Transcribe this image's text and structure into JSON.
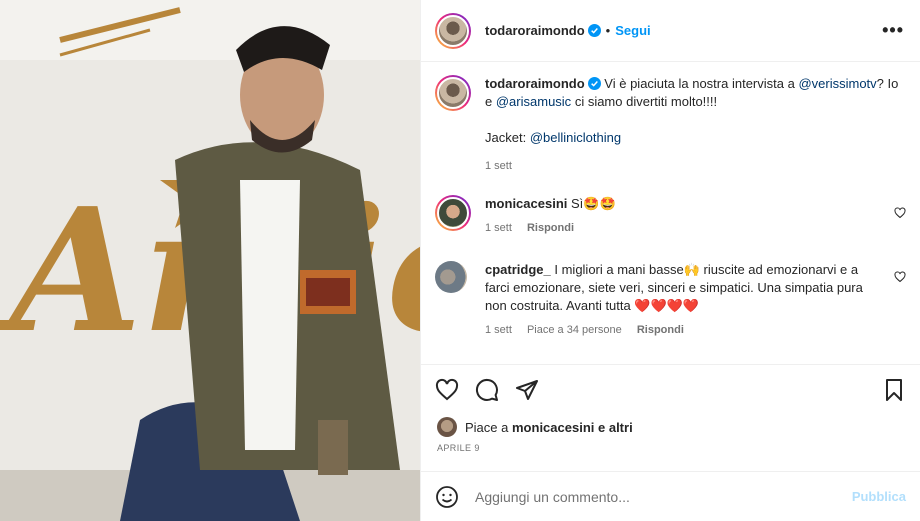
{
  "post": {
    "author": "todaroraimondo",
    "follow_label": "Segui",
    "separator": "•",
    "more_label": "•••",
    "photo_sign_text": "Amici"
  },
  "caption": {
    "author": "todaroraimondo",
    "text_1": "Vi è piaciuta la nostra intervista a",
    "mention_1": "@verissimotv",
    "text_2": "? Io e",
    "mention_2": "@arisamusic",
    "text_3": "ci siamo divertiti molto!!!!",
    "jacket_label": "Jacket:",
    "jacket_mention": "@belliniclothing",
    "time": "1 sett"
  },
  "comments": [
    {
      "author": "monicacesini",
      "text": "Sì🤩🤩",
      "time": "1 sett",
      "reply_label": "Rispondi"
    },
    {
      "author": "cpatridge_",
      "text": "I migliori a mani basse🙌 riuscite ad emozionarvi e a farci emozionare, siete veri, sinceri e simpatici. Una simpatia pura non costruita. Avanti tutta ❤️❤️❤️❤️",
      "time": "1 sett",
      "likes_label": "Piace a 34 persone",
      "reply_label": "Rispondi"
    }
  ],
  "likes": {
    "prefix": "Piace a",
    "user": "monicacesini",
    "suffix": "e altri"
  },
  "date": "APRILE 9",
  "add_comment": {
    "placeholder": "Aggiungi un commento...",
    "publish_label": "Pubblica"
  },
  "colors": {
    "accent": "#0095f6",
    "publish_disabled": "#b2dffc",
    "mention": "#00376b",
    "sign_gold": "#b8863a"
  },
  "icons": [
    "verified-icon",
    "more-icon",
    "heart-icon",
    "comment-icon",
    "share-icon",
    "bookmark-icon",
    "emoji-icon"
  ]
}
